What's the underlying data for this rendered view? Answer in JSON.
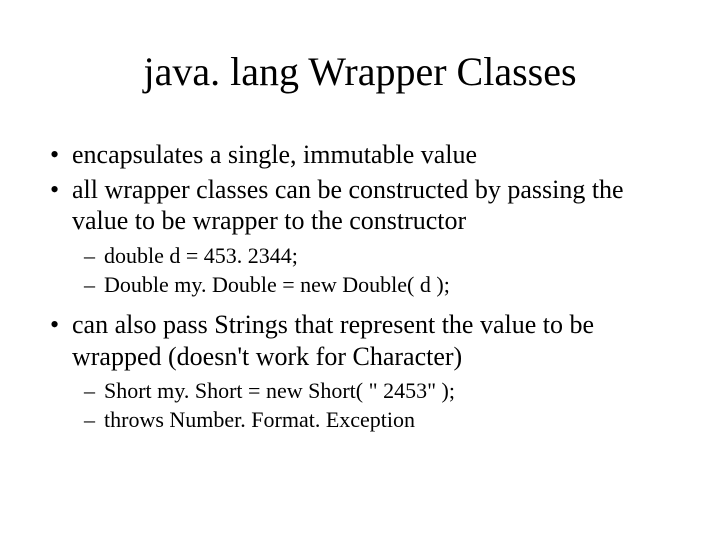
{
  "title": "java. lang Wrapper Classes",
  "bullets": [
    {
      "text": "encapsulates a single, immutable value",
      "sub": []
    },
    {
      "text": "all wrapper classes can be constructed by passing the value to be wrapper to the constructor",
      "sub": [
        "double d = 453. 2344;",
        "Double my. Double = new Double( d );"
      ]
    },
    {
      "text": "can also pass Strings that represent the value to be wrapped (doesn't work for Character)",
      "sub": [
        "Short my. Short = new Short( \" 2453\" );",
        "throws Number. Format. Exception"
      ]
    }
  ]
}
